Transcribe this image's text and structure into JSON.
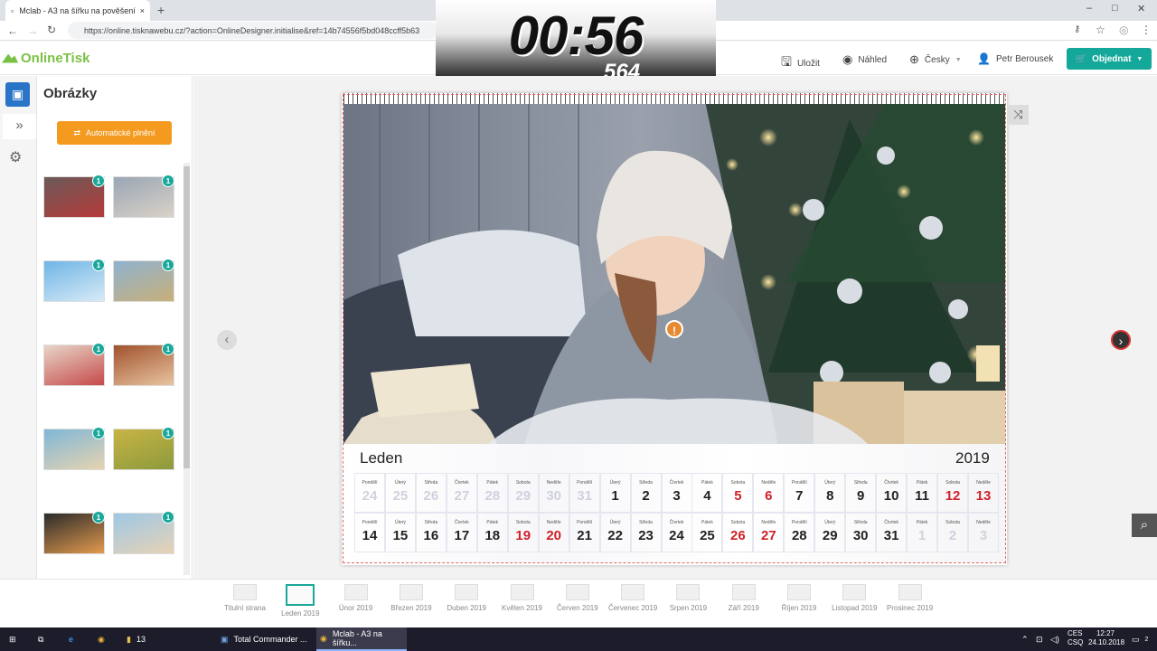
{
  "browser": {
    "tab_title": "Mclab - A3 na šířku na pověšení",
    "tab_close": "×",
    "new_tab": "+",
    "url": "https://online.tisknawebu.cz/?action=OnlineDesigner.initialise&ref=14b74556f5bd048ccff5b63",
    "win_min": "–",
    "win_max": "□",
    "win_close": "✕"
  },
  "timer": {
    "time": "00:56",
    "sub": "564"
  },
  "header": {
    "logo": "OnlineTisk",
    "save": "Uložit",
    "preview": "Náhled",
    "language": "Česky",
    "user": "Petr Berousek",
    "order": "Objednat"
  },
  "sidebar": {
    "title": "Obrázky",
    "autofill": "Automatické plnění",
    "thumbs": [
      {
        "badge": "1",
        "c1": "#6b5a58",
        "c2": "#b53a3a"
      },
      {
        "badge": "1",
        "c1": "#9aa6b4",
        "c2": "#d9d2c8"
      },
      {
        "badge": "1",
        "c1": "#6fb5e6",
        "c2": "#d7eaf6"
      },
      {
        "badge": "1",
        "c1": "#8fb2cf",
        "c2": "#c8b07a"
      },
      {
        "badge": "1",
        "c1": "#e7d6c8",
        "c2": "#c64a4a"
      },
      {
        "badge": "1",
        "c1": "#a0522d",
        "c2": "#e8c5a0"
      },
      {
        "badge": "1",
        "c1": "#7fb7d8",
        "c2": "#e6d3b0"
      },
      {
        "badge": "1",
        "c1": "#c8b445",
        "c2": "#8c9a3c"
      },
      {
        "badge": "1",
        "c1": "#2b2b2b",
        "c2": "#e39a4d"
      },
      {
        "badge": "1",
        "c1": "#9ec8e6",
        "c2": "#e7d2b5"
      }
    ]
  },
  "calendar": {
    "month": "Leden",
    "year": "2019",
    "rows": [
      [
        {
          "w": "Pondělí",
          "d": "24",
          "s": "dim"
        },
        {
          "w": "Úterý",
          "d": "25",
          "s": "dim"
        },
        {
          "w": "Středa",
          "d": "26",
          "s": "dim"
        },
        {
          "w": "Čtvrtek",
          "d": "27",
          "s": "dim"
        },
        {
          "w": "Pátek",
          "d": "28",
          "s": "dim"
        },
        {
          "w": "Sobota",
          "d": "29",
          "s": "dim"
        },
        {
          "w": "Neděle",
          "d": "30",
          "s": "dim"
        },
        {
          "w": "Pondělí",
          "d": "31",
          "s": "dim"
        },
        {
          "w": "Úterý",
          "d": "1",
          "s": ""
        },
        {
          "w": "Středa",
          "d": "2",
          "s": ""
        },
        {
          "w": "Čtvrtek",
          "d": "3",
          "s": ""
        },
        {
          "w": "Pátek",
          "d": "4",
          "s": ""
        },
        {
          "w": "Sobota",
          "d": "5",
          "s": "red"
        },
        {
          "w": "Neděle",
          "d": "6",
          "s": "red"
        },
        {
          "w": "Pondělí",
          "d": "7",
          "s": ""
        },
        {
          "w": "Úterý",
          "d": "8",
          "s": ""
        },
        {
          "w": "Středa",
          "d": "9",
          "s": ""
        },
        {
          "w": "Čtvrtek",
          "d": "10",
          "s": ""
        },
        {
          "w": "Pátek",
          "d": "11",
          "s": ""
        },
        {
          "w": "Sobota",
          "d": "12",
          "s": "red"
        },
        {
          "w": "Neděle",
          "d": "13",
          "s": "red"
        }
      ],
      [
        {
          "w": "Pondělí",
          "d": "14",
          "s": ""
        },
        {
          "w": "Úterý",
          "d": "15",
          "s": ""
        },
        {
          "w": "Středa",
          "d": "16",
          "s": ""
        },
        {
          "w": "Čtvrtek",
          "d": "17",
          "s": ""
        },
        {
          "w": "Pátek",
          "d": "18",
          "s": ""
        },
        {
          "w": "Sobota",
          "d": "19",
          "s": "red"
        },
        {
          "w": "Neděle",
          "d": "20",
          "s": "red"
        },
        {
          "w": "Pondělí",
          "d": "21",
          "s": ""
        },
        {
          "w": "Úterý",
          "d": "22",
          "s": ""
        },
        {
          "w": "Středa",
          "d": "23",
          "s": ""
        },
        {
          "w": "Čtvrtek",
          "d": "24",
          "s": ""
        },
        {
          "w": "Pátek",
          "d": "25",
          "s": ""
        },
        {
          "w": "Sobota",
          "d": "26",
          "s": "red"
        },
        {
          "w": "Neděle",
          "d": "27",
          "s": "red"
        },
        {
          "w": "Pondělí",
          "d": "28",
          "s": ""
        },
        {
          "w": "Úterý",
          "d": "29",
          "s": ""
        },
        {
          "w": "Středa",
          "d": "30",
          "s": ""
        },
        {
          "w": "Čtvrtek",
          "d": "31",
          "s": ""
        },
        {
          "w": "Pátek",
          "d": "1",
          "s": "dim"
        },
        {
          "w": "Sobota",
          "d": "2",
          "s": "dim"
        },
        {
          "w": "Neděle",
          "d": "3",
          "s": "dim"
        }
      ]
    ]
  },
  "pages": [
    "Titulní strana",
    "Leden 2019",
    "Únor 2019",
    "Březen 2019",
    "Duben 2019",
    "Květen 2019",
    "Červen 2019",
    "Červenec 2019",
    "Srpen 2019",
    "Září 2019",
    "Říjen 2019",
    "Listopad 2019",
    "Prosinec 2019"
  ],
  "selected_page": "Leden 2019",
  "taskbar": {
    "folder_count": "13",
    "app1": "Total Commander ...",
    "app2": "Mclab - A3 na šířku...",
    "lang": "CES",
    "lang2": "CSQ",
    "time": "12:27",
    "date": "24.10.2018",
    "notif": "2"
  }
}
